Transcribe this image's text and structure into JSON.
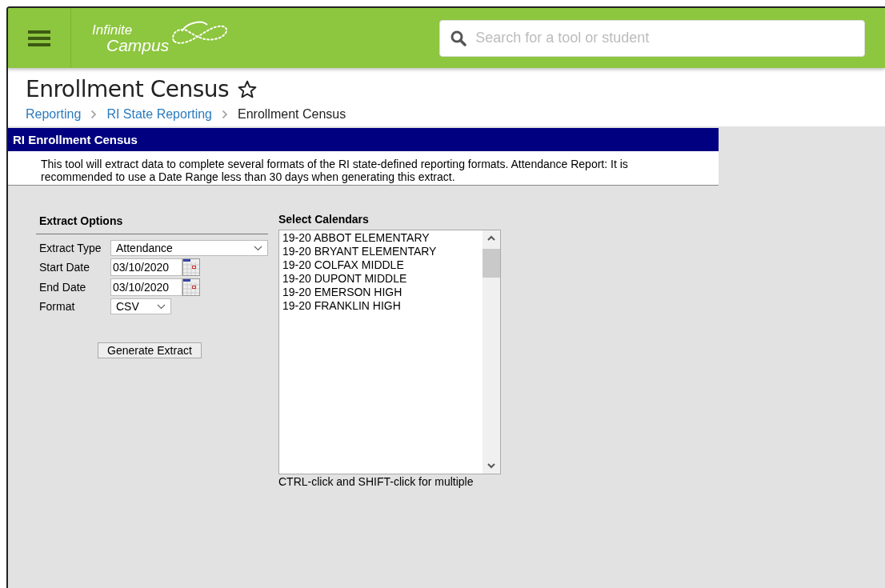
{
  "header": {
    "logo_line_1": "Infinite",
    "logo_line_2": "Campus",
    "search": {
      "placeholder": "Search for a tool or student"
    }
  },
  "page": {
    "title": "Enrollment Census",
    "favorite": false,
    "breadcrumbs": [
      {
        "label": "Reporting",
        "link": true
      },
      {
        "label": "RI State Reporting",
        "link": true
      },
      {
        "label": "Enrollment Census",
        "link": false
      }
    ]
  },
  "panel": {
    "title": "RI Enrollment Census",
    "description": "This tool will extract data to complete several formats of the RI state-defined reporting formats. Attendance Report: It is recommended to use a Date Range less than 30 days when generating this extract."
  },
  "extract_options": {
    "heading": "Extract Options",
    "fields": [
      {
        "kind": "select",
        "label": "Extract Type",
        "value": "Attendance"
      },
      {
        "kind": "date",
        "label": "Start Date",
        "value": "03/10/2020"
      },
      {
        "kind": "date",
        "label": "End Date",
        "value": "03/10/2020"
      },
      {
        "kind": "small-select",
        "label": "Format",
        "value": "CSV"
      }
    ],
    "button": "Generate Extract"
  },
  "calendars": {
    "heading": "Select Calendars",
    "items": [
      {
        "label": "19-20 ABBOT ELEMENTARY",
        "selected": false
      },
      {
        "label": "19-20 BRYANT ELEMENTARY",
        "selected": false
      },
      {
        "label": "19-20 COLFAX MIDDLE",
        "selected": false
      },
      {
        "label": "19-20 DUPONT MIDDLE",
        "selected": false
      },
      {
        "label": "19-20 EMERSON HIGH",
        "selected": false
      },
      {
        "label": "19-20 FRANKLIN HIGH",
        "selected": false
      }
    ],
    "hint": "CTRL-click and SHIFT-click for multiple"
  }
}
